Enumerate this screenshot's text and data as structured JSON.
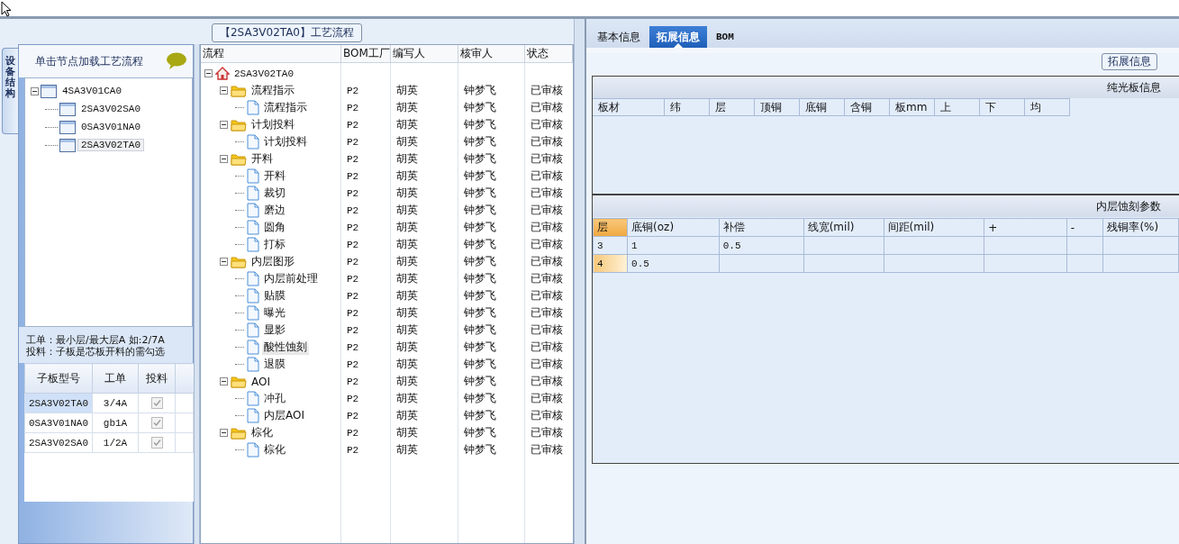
{
  "process_panel": {
    "title": "【2SA3V02TA0】工艺流程"
  },
  "side_tab": {
    "label": "设备结构"
  },
  "device_panel": {
    "hint": "单击节点加载工艺流程",
    "tree": [
      {
        "label": "4SA3V01CA0",
        "expanded": true,
        "selected": false,
        "children": [
          {
            "label": "2SA3V02SA0",
            "selected": false
          },
          {
            "label": "0SA3V01NA0",
            "selected": false
          },
          {
            "label": "2SA3V02TA0",
            "selected": true
          }
        ]
      }
    ],
    "notes": [
      "工单：最小层/最大层A 如:2/7A",
      "投料：子板是芯板开料的需勾选"
    ],
    "board_table": {
      "columns": [
        "子板型号",
        "工单",
        "投料"
      ],
      "rows": [
        {
          "model": "2SA3V02TA0",
          "order": "3/4A",
          "checked": true,
          "selected": true
        },
        {
          "model": "0SA3V01NA0",
          "order": "gb1A",
          "checked": true,
          "selected": false
        },
        {
          "model": "2SA3V02SA0",
          "order": "1/2A",
          "checked": true,
          "selected": false
        }
      ]
    }
  },
  "process_grid": {
    "columns": [
      "流程",
      "BOM工厂",
      "编写人",
      "核审人",
      "状态"
    ],
    "tree": [
      {
        "label": "2SA3V02TA0",
        "kind": "root",
        "expanded": true,
        "selected": false,
        "children": [
          {
            "label": "流程指示",
            "kind": "folder",
            "expanded": true,
            "selected": false,
            "bom": "P2",
            "writer": "胡英",
            "reviewer": "钟梦飞",
            "status": "已审核",
            "children": [
              {
                "label": "流程指示",
                "kind": "step",
                "selected": false,
                "bom": "P2",
                "writer": "胡英",
                "reviewer": "钟梦飞",
                "status": "已审核"
              }
            ]
          },
          {
            "label": "计划投料",
            "kind": "folder",
            "expanded": true,
            "selected": false,
            "bom": "P2",
            "writer": "胡英",
            "reviewer": "钟梦飞",
            "status": "已审核",
            "children": [
              {
                "label": "计划投料",
                "kind": "step",
                "selected": false,
                "bom": "P2",
                "writer": "胡英",
                "reviewer": "钟梦飞",
                "status": "已审核"
              }
            ]
          },
          {
            "label": "开料",
            "kind": "folder",
            "expanded": true,
            "selected": false,
            "bom": "P2",
            "writer": "胡英",
            "reviewer": "钟梦飞",
            "status": "已审核",
            "children": [
              {
                "label": "开料",
                "kind": "step",
                "selected": false,
                "bom": "P2",
                "writer": "胡英",
                "reviewer": "钟梦飞",
                "status": "已审核"
              },
              {
                "label": "裁切",
                "kind": "step",
                "selected": false,
                "bom": "P2",
                "writer": "胡英",
                "reviewer": "钟梦飞",
                "status": "已审核"
              },
              {
                "label": "磨边",
                "kind": "step",
                "selected": false,
                "bom": "P2",
                "writer": "胡英",
                "reviewer": "钟梦飞",
                "status": "已审核"
              },
              {
                "label": "圆角",
                "kind": "step",
                "selected": false,
                "bom": "P2",
                "writer": "胡英",
                "reviewer": "钟梦飞",
                "status": "已审核"
              },
              {
                "label": "打标",
                "kind": "step",
                "selected": false,
                "bom": "P2",
                "writer": "胡英",
                "reviewer": "钟梦飞",
                "status": "已审核"
              }
            ]
          },
          {
            "label": "内层图形",
            "kind": "folder",
            "expanded": true,
            "selected": false,
            "bom": "P2",
            "writer": "胡英",
            "reviewer": "钟梦飞",
            "status": "已审核",
            "children": [
              {
                "label": "内层前处理",
                "kind": "step",
                "selected": false,
                "bom": "P2",
                "writer": "胡英",
                "reviewer": "钟梦飞",
                "status": "已审核"
              },
              {
                "label": "贴膜",
                "kind": "step",
                "selected": false,
                "bom": "P2",
                "writer": "胡英",
                "reviewer": "钟梦飞",
                "status": "已审核"
              },
              {
                "label": "曝光",
                "kind": "step",
                "selected": false,
                "bom": "P2",
                "writer": "胡英",
                "reviewer": "钟梦飞",
                "status": "已审核"
              },
              {
                "label": "显影",
                "kind": "step",
                "selected": false,
                "bom": "P2",
                "writer": "胡英",
                "reviewer": "钟梦飞",
                "status": "已审核"
              },
              {
                "label": "酸性蚀刻",
                "kind": "step",
                "selected": true,
                "bom": "P2",
                "writer": "胡英",
                "reviewer": "钟梦飞",
                "status": "已审核"
              },
              {
                "label": "退膜",
                "kind": "step",
                "selected": false,
                "bom": "P2",
                "writer": "胡英",
                "reviewer": "钟梦飞",
                "status": "已审核"
              }
            ]
          },
          {
            "label": "AOI",
            "kind": "folder",
            "expanded": true,
            "selected": false,
            "bom": "P2",
            "writer": "胡英",
            "reviewer": "钟梦飞",
            "status": "已审核",
            "children": [
              {
                "label": "冲孔",
                "kind": "step",
                "selected": false,
                "bom": "P2",
                "writer": "胡英",
                "reviewer": "钟梦飞",
                "status": "已审核"
              },
              {
                "label": "内层AOI",
                "kind": "step",
                "selected": false,
                "bom": "P2",
                "writer": "胡英",
                "reviewer": "钟梦飞",
                "status": "已审核"
              }
            ]
          },
          {
            "label": "棕化",
            "kind": "folder",
            "expanded": true,
            "selected": false,
            "bom": "P2",
            "writer": "胡英",
            "reviewer": "钟梦飞",
            "status": "已审核",
            "children": [
              {
                "label": "棕化",
                "kind": "step",
                "selected": false,
                "bom": "P2",
                "writer": "胡英",
                "reviewer": "钟梦飞",
                "status": "已审核"
              }
            ]
          }
        ]
      }
    ]
  },
  "tabs": [
    {
      "label": "基本信息",
      "selected": false
    },
    {
      "label": "拓展信息",
      "selected": true
    },
    {
      "label": "BOM",
      "selected": false
    }
  ],
  "extended_panel": {
    "title": "拓展信息",
    "board_info": {
      "title": "纯光板信息",
      "columns": [
        "板材",
        "纬",
        "层",
        "顶铜",
        "底铜",
        "含铜",
        "板mm",
        "上",
        "下",
        "均"
      ]
    },
    "etch_params": {
      "title": "内层蚀刻参数",
      "row_header": "层",
      "columns": [
        "底铜(oz)",
        "补偿",
        "线宽(mil)",
        "间距(mil)",
        "+",
        "-",
        "残铜率(%)"
      ],
      "rows": [
        {
          "layer": "3",
          "values": [
            "1",
            "0.5"
          ],
          "selected": false
        },
        {
          "layer": "4",
          "values": [
            "0.5"
          ],
          "selected": true
        }
      ]
    }
  }
}
